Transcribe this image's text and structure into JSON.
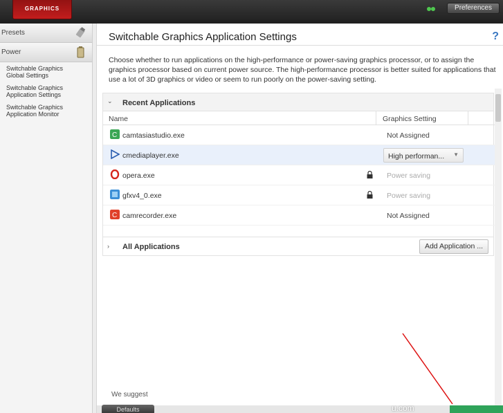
{
  "topbar": {
    "logo_text": "GRAPHICS",
    "preferences_label": "Preferences"
  },
  "sidebar": {
    "categories": [
      {
        "label": "Presets"
      },
      {
        "label": "Power"
      }
    ],
    "items": [
      {
        "label": "Switchable Graphics Global Settings"
      },
      {
        "label": "Switchable Graphics Application Settings"
      },
      {
        "label": "Switchable Graphics Application Monitor"
      }
    ]
  },
  "main": {
    "title": "Switchable Graphics Application Settings",
    "help": "?",
    "description": "Choose whether to run applications on the high-performance or power-saving graphics processor, or to assign the graphics processor based on current power source. The high-performance processor is better suited for applications that use a lot of 3D graphics or video or seem to run poorly on the power-saving setting.",
    "recent": {
      "label": "Recent Applications",
      "columns": {
        "name": "Name",
        "setting": "Graphics Setting"
      },
      "rows": [
        {
          "name": "camtasiastudio.exe",
          "setting": "Not Assigned",
          "icon": "camtasia-icon",
          "color": "#3aa655"
        },
        {
          "name": "cmediaplayer.exe",
          "setting": "High performan...",
          "icon": "play-icon",
          "color": "#2a5db0"
        },
        {
          "name": "opera.exe",
          "setting": "Power saving",
          "icon": "opera-icon",
          "color": "#d6261c"
        },
        {
          "name": "gfxv4_0.exe",
          "setting": "Power saving",
          "icon": "gfx-icon",
          "color": "#3b8fd6"
        },
        {
          "name": "camrecorder.exe",
          "setting": "Not Assigned",
          "icon": "recorder-icon",
          "color": "#e0402a"
        }
      ]
    },
    "all_apps": {
      "label": "All Applications",
      "add_button": "Add Application ..."
    },
    "suggest_text": "We suggest",
    "defaults_label": "Defaults",
    "watermark": "u.com"
  }
}
